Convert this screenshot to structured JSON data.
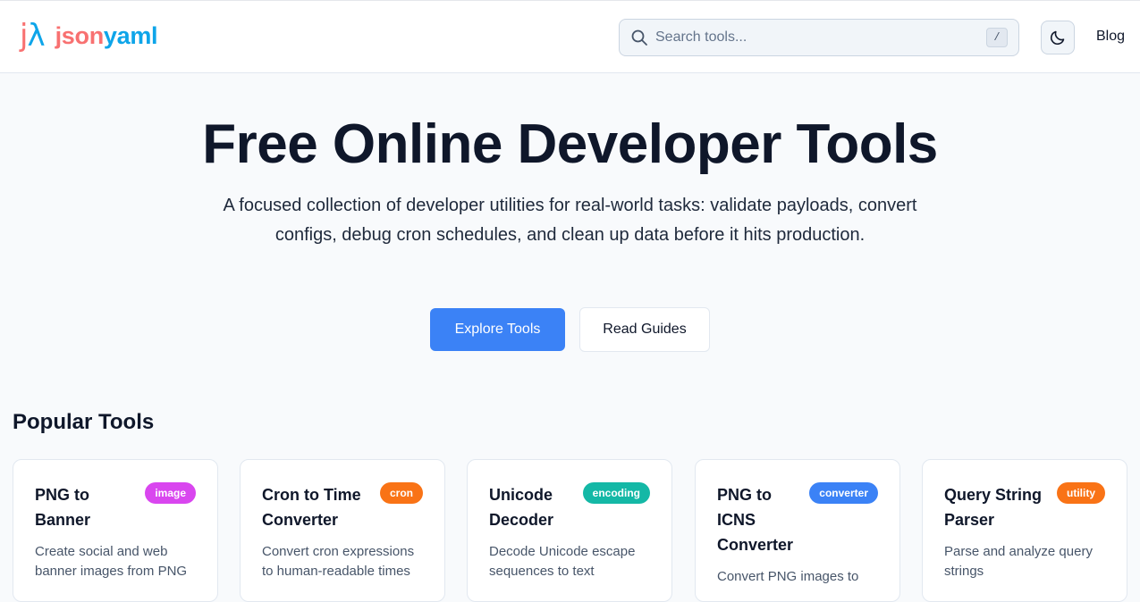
{
  "header": {
    "logo_mark_j": "j",
    "logo_mark_lambda": "λ",
    "logo_text_a": "json",
    "logo_text_b": "yaml",
    "search_placeholder": "Search tools...",
    "search_shortcut": "/",
    "theme_toggle_icon": "moon-icon",
    "blog_label": "Blog"
  },
  "hero": {
    "title": "Free Online Developer Tools",
    "subtitle": "A focused collection of developer utilities for real-world tasks: validate payloads, convert configs, debug cron schedules, and clean up data before it hits production.",
    "primary_button": "Explore Tools",
    "secondary_button": "Read Guides"
  },
  "popular": {
    "heading": "Popular Tools",
    "cards": [
      {
        "title": "PNG to Banner",
        "badge": "image",
        "badge_color": "#d946ef",
        "description": "Create social and web banner images from PNG"
      },
      {
        "title": "Cron to Time Converter",
        "badge": "cron",
        "badge_color": "#f97316",
        "description": "Convert cron expressions to human-readable times"
      },
      {
        "title": "Unicode Decoder",
        "badge": "encoding",
        "badge_color": "#14b8a6",
        "description": "Decode Unicode escape sequences to text"
      },
      {
        "title": "PNG to ICNS Converter",
        "badge": "converter",
        "badge_color": "#3b82f6",
        "description": "Convert PNG images to"
      },
      {
        "title": "Query String Parser",
        "badge": "utility",
        "badge_color": "#f97316",
        "description": "Parse and analyze query strings"
      }
    ]
  },
  "colors": {
    "accent": "#3b82f6",
    "logo_red": "#f87171",
    "logo_blue": "#0ea5e9",
    "background": "#f8fafc"
  }
}
